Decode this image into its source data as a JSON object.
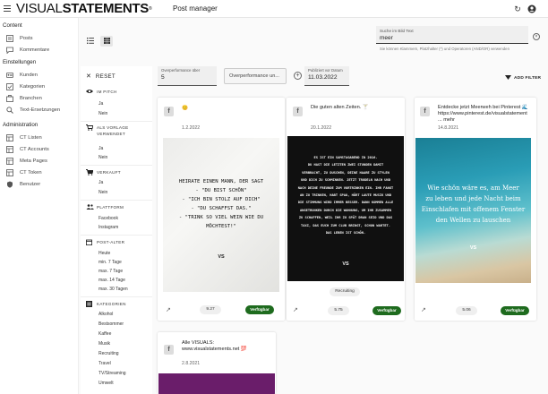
{
  "header": {
    "logo_light": "VISUAL",
    "logo_bold": "STATEMENTS",
    "logo_mark": "®",
    "title": "Post manager"
  },
  "sidebar": {
    "sections": [
      {
        "title": "Content",
        "items": [
          {
            "label": "Posts",
            "icon": "posts-icon"
          },
          {
            "label": "Kommentare",
            "icon": "comments-icon"
          }
        ]
      },
      {
        "title": "Einstellungen",
        "items": [
          {
            "label": "Kunden",
            "icon": "customers-icon"
          },
          {
            "label": "Kategorien",
            "icon": "categories-icon"
          },
          {
            "label": "Branchen",
            "icon": "industries-icon"
          },
          {
            "label": "Text-Ersetzungen",
            "icon": "text-replace-icon"
          }
        ]
      },
      {
        "title": "Administration",
        "items": [
          {
            "label": "CT Listen",
            "icon": "ct-lists-icon"
          },
          {
            "label": "CT Accounts",
            "icon": "ct-accounts-icon"
          },
          {
            "label": "Meta Pages",
            "icon": "meta-pages-icon"
          },
          {
            "label": "CT Token",
            "icon": "ct-token-icon"
          },
          {
            "label": "Benutzer",
            "icon": "users-icon"
          }
        ]
      }
    ]
  },
  "search": {
    "label": "Suche im Bild Text",
    "value": "meer",
    "hint": "Sie können Klammern, Platzhalter (*) und Operatoren (AND/OR) verwenden"
  },
  "filters": {
    "reset_label": "RESET",
    "groups": [
      {
        "label": "IM PITCH",
        "icon": "eye-icon",
        "options": [
          "Ja",
          "Nein"
        ]
      },
      {
        "label": "ALS VORLAGE VERWENDET",
        "icon": "cart-icon",
        "options": [
          "Ja",
          "Nein"
        ]
      },
      {
        "label": "VERKAUFT",
        "icon": "cart-sold-icon",
        "options": [
          "Ja",
          "Nein"
        ]
      },
      {
        "label": "PLATTFORM",
        "icon": "people-icon",
        "options": [
          "Facebook",
          "Instagram"
        ]
      },
      {
        "label": "POST-ALTER",
        "icon": "calendar-icon",
        "options": [
          "Heute",
          "min. 7 Tage",
          "max. 7 Tage",
          "max. 14 Tage",
          "max. 30 Tagen"
        ]
      },
      {
        "label": "KATEGORIEN",
        "icon": "category-list-icon",
        "options": [
          "Alkohol",
          "Bestsommer",
          "Kaffee",
          "Musik",
          "Recruiting",
          "Travel",
          "TV/Streaming",
          "Umwelt"
        ]
      }
    ]
  },
  "filterbar": {
    "performance_label": "Overperformance über",
    "performance_value": "5",
    "performance_select": "Overperformance un...",
    "date_label": "Publiziert vor Datum",
    "date_value": "11.03.2022",
    "add_filter": "ADD FILTER"
  },
  "cards": [
    {
      "text": "😊",
      "date": "1.2.2022",
      "quote_lines": [
        "HEIRATE EINEN MANN, DER SAGT",
        "- \"DU BIST SCHÖN\"",
        "- \"ICH BIN STOLZ AUF DICH\"",
        "- \"DU SCHAFFST DAS.\"",
        "- \"TRINK SO VIEL WEIN WIE DU MÖCHTEST!\""
      ],
      "signet": "VS",
      "category": "",
      "score": "9.27",
      "action": "Verfügbar"
    },
    {
      "text": "Die guten alten Zeiten. 🍸",
      "date": "20.1.2022",
      "quote_lines": [
        "ES IST EIN SAMSTAGABEND IN 2016.",
        "DU HAST DIE LETZTEN ZWEI STUNDEN DAMIT",
        "VERBRACHT, ZU DUSCHEN, DEINE HAARE ZU STYLEN",
        "UND DICH ZU SCHMINKEN. JETZT TRUDELN NACH UND",
        "NACH DEINE FREUNDE ZUM VORTRINKEN EIN. IHR FANGT",
        "AN ZU TRINKEN, HABT SPAß, HÖRT LAUTE MUSIK UND",
        "DIE STIMMUNG WIRD IMMER BESSER. DANN KOMMEN ALLE",
        "ANGETRUNKEN DURCH DIE WOHNUNG, UM IHR ZUSAMMEN",
        "ZU SCHAFFEN, WEIL IHR ZU SPÄT DRAN SEID UND DAS",
        "TAXI, DAS EUCH ZUM CLUB BRINGT, SCHON WARTET.",
        "DAS LEBEN IST SCHÖN."
      ],
      "signet": "VS",
      "category": "Recruiting",
      "score": "5.75",
      "action": "Verfügbar"
    },
    {
      "text": "Entdecke jetzt Meerweh bei Pinterest 🌊 https://www.pinterest.de/visualstatement ... mehr",
      "date": "14.8.2021",
      "quote_lines": [
        "Wie schön wäre es, am Meer",
        "zu leben und jede Nacht beim",
        "Einschlafen mit offenem Fenster",
        "den Wellen zu lauschen"
      ],
      "signet": "VS",
      "category": "",
      "score": "5.06",
      "action": "Verfügbar"
    },
    {
      "text": "Alle VISUALS: www.visualstatements.net 💯",
      "date": "2.8.2021",
      "quote_lines": [],
      "signet": "",
      "category": "",
      "score": "",
      "action": ""
    }
  ],
  "colors": {
    "accent_green": "#1e6b1e",
    "purple_image": "#6a1d6a",
    "card3_sea": "#2a8fa8"
  }
}
